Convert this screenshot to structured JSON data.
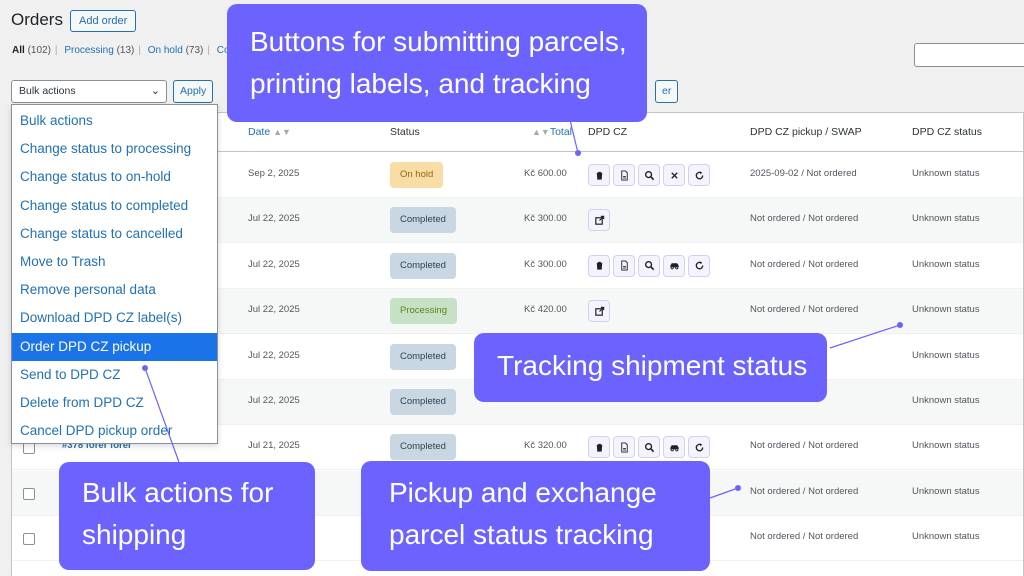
{
  "header": {
    "title": "Orders",
    "add_label": "Add order"
  },
  "status_filters": [
    {
      "label": "All",
      "count": "(102)"
    },
    {
      "label": "Processing",
      "count": "(13)"
    },
    {
      "label": "On hold",
      "count": "(73)"
    },
    {
      "label": "Cor"
    }
  ],
  "toolbar": {
    "bulk_selected": "Bulk actions",
    "apply_label": "Apply",
    "filter_label": "er"
  },
  "columns": {
    "date": "Date",
    "status": "Status",
    "total": "Total",
    "dpd": "DPD CZ",
    "pickup": "DPD CZ pickup / SWAP",
    "dpd_status": "DPD CZ status"
  },
  "bulk_menu": [
    "Bulk actions",
    "Change status to processing",
    "Change status to on-hold",
    "Change status to completed",
    "Change status to cancelled",
    "Move to Trash",
    "Remove personal data",
    "Download DPD CZ label(s)",
    "Order DPD CZ pickup",
    "Send to DPD CZ",
    "Delete from DPD CZ",
    "Cancel DPD pickup order"
  ],
  "bulk_menu_selected_index": 8,
  "status_colors": {
    "On hold": {
      "bg": "#f8dda7",
      "fg": "#94660c"
    },
    "Completed": {
      "bg": "#c8d7e1",
      "fg": "#2e4453"
    },
    "Processing": {
      "bg": "#c6e1c6",
      "fg": "#5b841b"
    }
  },
  "rows": [
    {
      "order": "",
      "date": "Sep 2, 2025",
      "status": "On hold",
      "total": "Kč 600.00",
      "actions": [
        "trash-icon",
        "label-icon",
        "search-icon",
        "close-icon",
        "refresh-icon"
      ],
      "pickup": "2025-09-02 / Not ordered",
      "dpd_status": "Unknown status"
    },
    {
      "order": "",
      "date": "Jul 22, 2025",
      "status": "Completed",
      "total": "Kč 300.00",
      "actions": [
        "send-icon"
      ],
      "pickup": "Not ordered / Not ordered",
      "dpd_status": "Unknown status"
    },
    {
      "order": "",
      "date": "Jul 22, 2025",
      "status": "Completed",
      "total": "Kč 300.00",
      "actions": [
        "trash-icon",
        "label-icon",
        "search-icon",
        "car-icon",
        "refresh-icon"
      ],
      "pickup": "Not ordered / Not ordered",
      "dpd_status": "Unknown status"
    },
    {
      "order": "",
      "date": "Jul 22, 2025",
      "status": "Processing",
      "total": "Kč 420.00",
      "actions": [
        "send-icon"
      ],
      "pickup": "Not ordered / Not ordered",
      "dpd_status": "Unknown status"
    },
    {
      "order": "",
      "date": "Jul 22, 2025",
      "status": "Completed",
      "total": "",
      "actions": [],
      "pickup": "",
      "dpd_status": "Unknown status"
    },
    {
      "order": "",
      "date": "Jul 22, 2025",
      "status": "Completed",
      "total": "",
      "actions": [],
      "pickup": "",
      "dpd_status": "Unknown status"
    },
    {
      "order": "#378 forer forer",
      "date": "Jul 21, 2025",
      "status": "Completed",
      "total": "Kč 320.00",
      "actions": [
        "trash-icon",
        "label-icon",
        "search-icon",
        "car-icon",
        "refresh-icon"
      ],
      "pickup": "Not ordered / Not ordered",
      "dpd_status": "Unknown status"
    },
    {
      "order": "",
      "date": "",
      "status": "",
      "total": "",
      "actions": [],
      "pickup": "Not ordered / Not ordered",
      "dpd_status": "Unknown status"
    },
    {
      "order": "",
      "date": "",
      "status": "",
      "total": "",
      "actions": [],
      "pickup": "Not ordered / Not ordered",
      "dpd_status": "Unknown status"
    }
  ],
  "callouts": {
    "buttons": "Buttons for submitting parcels, printing labels, and tracking",
    "buttons_line1": "Buttons for submitting parcels,",
    "buttons_line2": "printing labels, and tracking",
    "tracking": "Tracking shipment status",
    "bulk_line1": "Bulk actions for",
    "bulk_line2": "shipping",
    "pickup_line1": "Pickup and exchange",
    "pickup_line2": "parcel status tracking"
  },
  "accent_color": "#6c63ff"
}
